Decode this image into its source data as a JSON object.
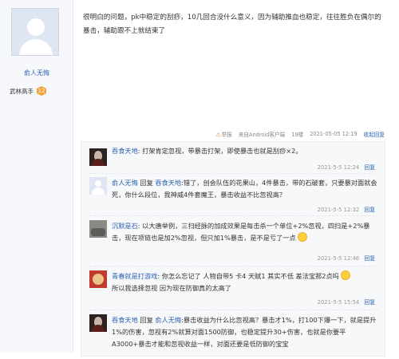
{
  "post": {
    "author": "俞人无悔",
    "rank_title": "武林高手",
    "rank_level": "12",
    "content": "很明白的问题，pk中稳定的刮痧，10几回合没什么意义，因为辅助推血也稳定，往往胜负在偶尔的暴击，辅助跟不上就结束了",
    "meta": {
      "report": "举报",
      "source": "来自Android客户端",
      "floor": "19楼",
      "datetime": "2021-05-05 12:19",
      "collapse": "收起回复"
    }
  },
  "replies": [
    {
      "user": "吞食天地",
      "text": "打架肯定忽视，带暴击打架，即使暴击也就是刮痧×2。",
      "time": "2021-5-5 12:24",
      "reply_word": "回复"
    },
    {
      "user": "俞人无悔",
      "reply_word": "回复",
      "target": "吞食天地",
      "text": ":错了，创会队伍的花果山，4件暴击，带的石破套，只要暴对面就会死，你什么段位，我神威4件套魔王，暴击收益不比忽视高？",
      "time": "2021-5-5 12:32"
    },
    {
      "user": "沉默是石",
      "text": "以大唐举例，三扫经脉的加成效果是每击杀一个单位+2%忽视，四扫是+2%暴击，现在项链也是加2%忽视，但只加1%暴击，是不是亏了一点",
      "time": "2021-5-5 12:46",
      "reply_word": "回复"
    },
    {
      "user": "青春就是打游戏",
      "text": "你怎么忘记了 人物自带5 卡4 天赋1 其实不低 差法宝那2点吗",
      "text2": "所以我选择忽视 因为现在防御真的太高了",
      "time": "2021-5-5 15:54",
      "reply_word": "回复"
    },
    {
      "user": "吞食天地",
      "reply_word": "回复",
      "target": "俞人无悔",
      "text": ":暴击收益为什么比忽视高？暴击才1%，打100下爆一下，就是提升1%的伤害，忽视有2%就算对面1500防御，也稳定提升30+伤害，也就是你要平A3000+暴击才能和忽视收益一样，对面还要是低防御的宝宝"
    }
  ]
}
